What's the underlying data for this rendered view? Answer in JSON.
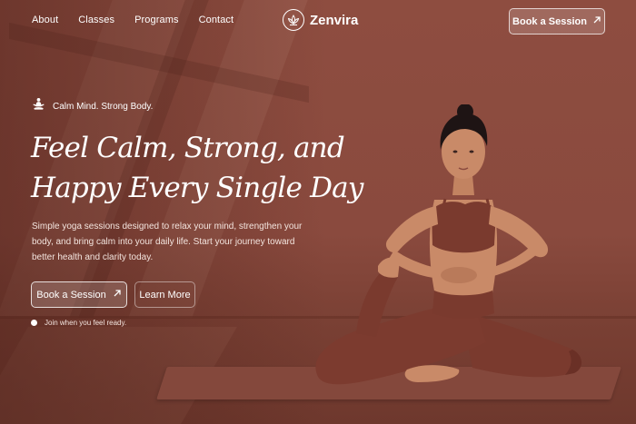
{
  "nav": {
    "links": [
      "About",
      "Classes",
      "Programs",
      "Contact"
    ],
    "brand": "Zenvira",
    "cta_label": "Book a Session"
  },
  "hero": {
    "tagline": "Calm Mind. Strong Body.",
    "headline_line1": "Feel Calm, Strong, and",
    "headline_line2": "Happy Every Single Day",
    "description": "Simple yoga sessions designed to relax your mind, strengthen your body, and bring calm into your daily life. Start your journey toward better health and clarity today.",
    "primary_cta": "Book a Session",
    "secondary_cta": "Learn More",
    "note": "Join when you feel ready."
  },
  "icons": {
    "brand": "lotus-icon",
    "tagline": "meditation-icon",
    "cta": "arrow-up-right-icon"
  },
  "colors": {
    "background": "#8a4a3e",
    "text": "#ffffff",
    "skin": "#c98a68",
    "outfit": "#7a3a2e"
  }
}
